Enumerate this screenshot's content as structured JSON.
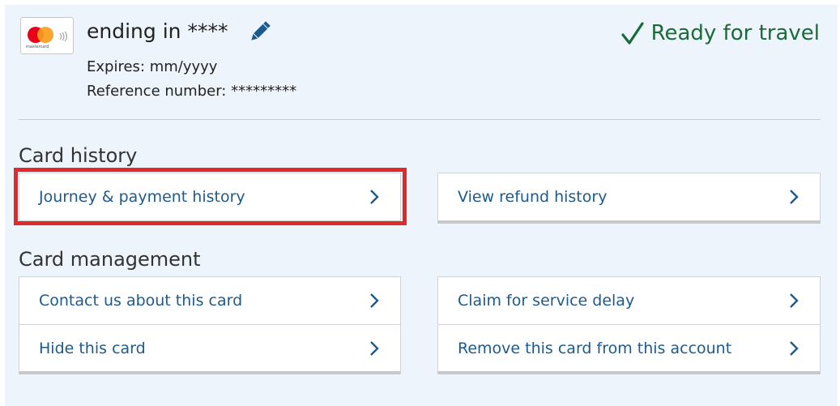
{
  "card": {
    "brand_text": "mastercard",
    "title": "ending in ****",
    "expires": "Expires: mm/yyyy",
    "reference": "Reference number: *********"
  },
  "status": {
    "label": "Ready for travel",
    "color": "#1a6b3a"
  },
  "card_history": {
    "heading": "Card history",
    "links": [
      {
        "label": "Journey & payment history",
        "icon": "chevron-right-icon",
        "highlighted": true
      },
      {
        "label": "View refund history",
        "icon": "chevron-right-icon"
      }
    ]
  },
  "card_management": {
    "heading": "Card management",
    "links": [
      {
        "label": "Contact us about this card",
        "icon": "chevron-right-icon"
      },
      {
        "label": "Hide this card",
        "icon": "chevron-right-icon"
      },
      {
        "label": "Claim for service delay",
        "icon": "chevron-right-icon"
      },
      {
        "label": "Remove this card from this account",
        "icon": "chevron-right-icon"
      }
    ]
  },
  "colors": {
    "link": "#1d5a8c",
    "highlight": "#e02a2a",
    "panel_bg": "#eef4fb"
  }
}
